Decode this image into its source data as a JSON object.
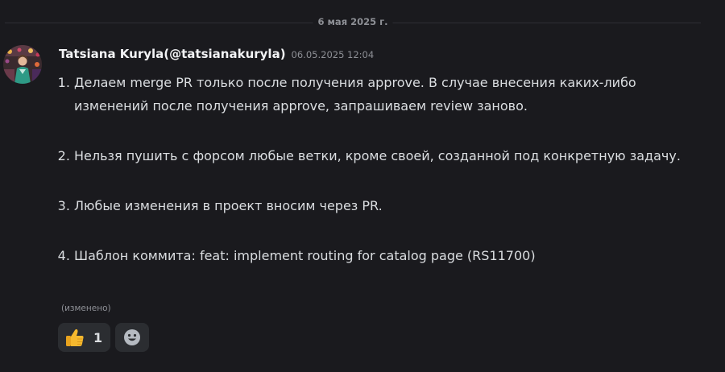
{
  "date_divider": "6 мая 2025 г.",
  "message": {
    "author": "Tatsiana Kuryla(@tatsianakuryla)",
    "timestamp": "06.05.2025 12:04",
    "items": [
      "Делаем merge PR только после получения approve. В случае внесения каких-либо изменений после получения approve, запрашиваем review заново.",
      "Нельзя пушить с форсом любые ветки, кроме своей, созданной под конкретную задачу.",
      "Любые изменения в проект вносим через PR.",
      "Шаблон коммита: feat: implement routing for catalog page (RS11700)"
    ],
    "edited_label": "(изменено)",
    "reactions": [
      {
        "icon": "thumbs-up-icon",
        "count": "1"
      }
    ],
    "add_reaction_icon": "smiley-icon"
  },
  "colors": {
    "background": "#1a1a1e",
    "text": "#dbdee1",
    "muted": "#8e9096",
    "reaction_bg": "#2b2d31",
    "thumb_yellow": "#f5b82e"
  }
}
